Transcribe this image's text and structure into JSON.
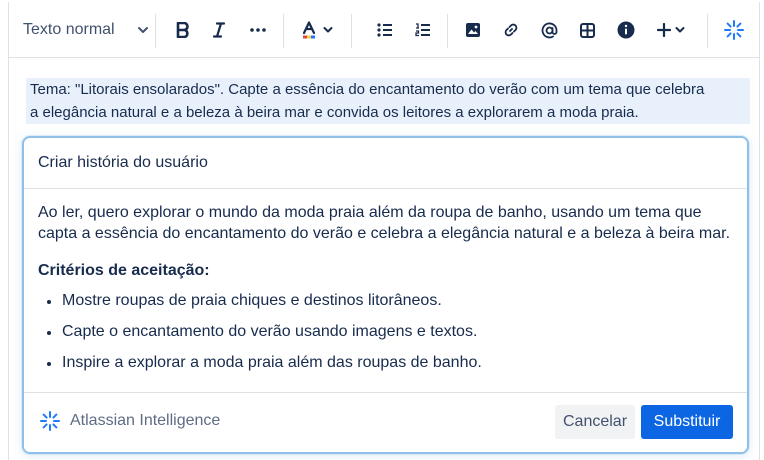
{
  "toolbar": {
    "text_style": "Texto normal"
  },
  "selection": {
    "lines": [
      "Tema: \"Litorais ensolarados\". Capte a essência do encantamento do verão com um tema que celebra",
      "a elegância natural e a beleza à beira mar e convida os leitores a explorarem a moda praia."
    ]
  },
  "ai_panel": {
    "prompt_value": "Criar história do usuário",
    "paragraph": "Ao ler, quero explorar o mundo da moda praia além da roupa de banho, usando um tema que capta a essência do encantamento do verão e celebra a elegância natural e a beleza à beira mar.",
    "criteria_heading": "Critérios de aceitação:",
    "criteria": [
      "Mostre roupas de praia chiques e destinos litorâneos.",
      "Capte o encantamento do verão usando imagens e textos.",
      "Inspire a explorar a moda praia além das roupas de banho."
    ],
    "brand_name": "Atlassian Intelligence",
    "cancel_label": "Cancelar",
    "replace_label": "Substituir"
  },
  "colors": {
    "accent": "#0c66e4",
    "selection_highlight": "#e8f1fb",
    "ai_border": "#8fc0ea",
    "ai_icon": "#1d7afc"
  },
  "icons": [
    "chevron-down-icon",
    "bold-icon",
    "italic-icon",
    "more-icon",
    "text-color-icon",
    "bullet-list-icon",
    "numbered-list-icon",
    "image-icon",
    "link-icon",
    "mention-icon",
    "table-icon",
    "info-icon",
    "insert-plus-icon",
    "atlassian-intelligence-icon"
  ]
}
